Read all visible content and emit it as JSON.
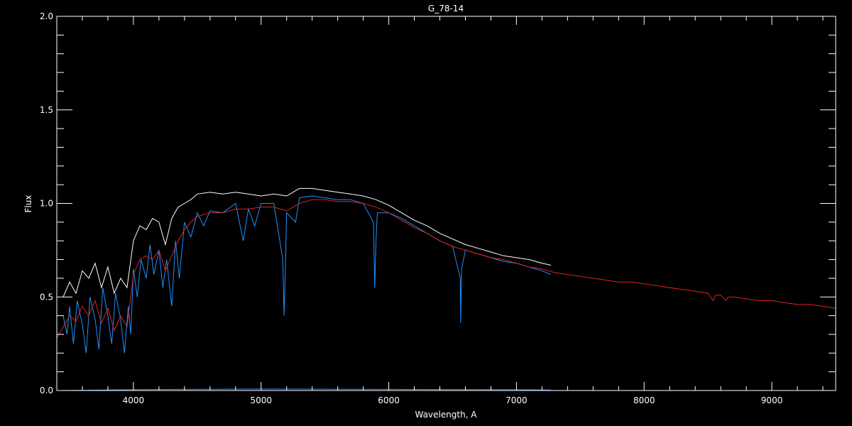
{
  "chart_data": {
    "type": "line",
    "title": "G_78-14",
    "xlabel": "Wavelength, A",
    "ylabel": "Flux",
    "xlim": [
      3400,
      9500
    ],
    "ylim": [
      0,
      2.0
    ],
    "x_ticks": [
      4000,
      5000,
      6000,
      7000,
      8000,
      9000
    ],
    "x_tick_labels": [
      "4000",
      "5000",
      "6000",
      "7000",
      "8000",
      "9000"
    ],
    "y_ticks": [
      0.0,
      0.5,
      1.0,
      1.5,
      2.0
    ],
    "y_tick_labels": [
      "0.0",
      "0.5",
      "1.0",
      "1.5",
      "2.0"
    ],
    "background": "#000000",
    "axis_color": "#ffffff",
    "series": [
      {
        "color": "#ffffff",
        "x": [
          3450,
          3500,
          3550,
          3600,
          3650,
          3700,
          3750,
          3800,
          3850,
          3900,
          3950,
          4000,
          4050,
          4100,
          4150,
          4200,
          4250,
          4300,
          4350,
          4400,
          4450,
          4500,
          4600,
          4700,
          4800,
          4900,
          5000,
          5100,
          5200,
          5300,
          5400,
          5500,
          5600,
          5700,
          5800,
          5900,
          6000,
          6100,
          6200,
          6300,
          6400,
          6500,
          6600,
          6700,
          6800,
          6900,
          7000,
          7100,
          7200,
          7270
        ],
        "y": [
          0.5,
          0.58,
          0.52,
          0.64,
          0.6,
          0.68,
          0.55,
          0.66,
          0.52,
          0.6,
          0.55,
          0.8,
          0.88,
          0.86,
          0.92,
          0.9,
          0.78,
          0.92,
          0.98,
          1.0,
          1.02,
          1.05,
          1.06,
          1.05,
          1.06,
          1.05,
          1.04,
          1.05,
          1.04,
          1.08,
          1.08,
          1.07,
          1.06,
          1.05,
          1.04,
          1.02,
          0.99,
          0.95,
          0.91,
          0.88,
          0.84,
          0.81,
          0.78,
          0.76,
          0.74,
          0.72,
          0.71,
          0.7,
          0.68,
          0.67
        ]
      },
      {
        "color": "#1e90ff",
        "x": [
          3450,
          3480,
          3500,
          3530,
          3560,
          3600,
          3630,
          3660,
          3700,
          3730,
          3760,
          3800,
          3830,
          3860,
          3900,
          3930,
          3960,
          3980,
          4000,
          4030,
          4060,
          4100,
          4130,
          4160,
          4200,
          4230,
          4260,
          4300,
          4330,
          4360,
          4400,
          4450,
          4500,
          4550,
          4600,
          4700,
          4800,
          4860,
          4900,
          4950,
          5000,
          5100,
          5170,
          5180,
          5190,
          5200,
          5270,
          5300,
          5400,
          5500,
          5600,
          5700,
          5800,
          5880,
          5890,
          5900,
          5910,
          6000,
          6100,
          6200,
          6300,
          6400,
          6500,
          6560,
          6563,
          6570,
          6600,
          6700,
          6800,
          6900,
          7000,
          7100,
          7200,
          7270
        ],
        "y": [
          0.4,
          0.3,
          0.45,
          0.25,
          0.48,
          0.35,
          0.2,
          0.5,
          0.38,
          0.22,
          0.55,
          0.4,
          0.25,
          0.52,
          0.38,
          0.2,
          0.45,
          0.3,
          0.65,
          0.5,
          0.7,
          0.6,
          0.78,
          0.62,
          0.75,
          0.55,
          0.7,
          0.45,
          0.8,
          0.6,
          0.9,
          0.82,
          0.95,
          0.88,
          0.96,
          0.95,
          1.0,
          0.8,
          0.97,
          0.88,
          1.0,
          1.0,
          0.7,
          0.4,
          0.65,
          0.95,
          0.9,
          1.03,
          1.04,
          1.03,
          1.02,
          1.02,
          1.0,
          0.9,
          0.55,
          0.8,
          0.95,
          0.95,
          0.92,
          0.88,
          0.84,
          0.8,
          0.77,
          0.6,
          0.36,
          0.65,
          0.75,
          0.73,
          0.71,
          0.69,
          0.68,
          0.66,
          0.64,
          0.62
        ]
      },
      {
        "color": "#e02020",
        "x": [
          3400,
          3450,
          3500,
          3550,
          3600,
          3650,
          3700,
          3750,
          3800,
          3850,
          3900,
          3950,
          4000,
          4050,
          4100,
          4150,
          4200,
          4250,
          4300,
          4350,
          4400,
          4450,
          4500,
          4600,
          4700,
          4800,
          4900,
          5000,
          5100,
          5200,
          5300,
          5400,
          5500,
          5600,
          5700,
          5800,
          5900,
          6000,
          6100,
          6200,
          6300,
          6400,
          6500,
          6600,
          6700,
          6800,
          6900,
          7000,
          7100,
          7200,
          7300,
          7400,
          7500,
          7600,
          7700,
          7800,
          7900,
          8000,
          8100,
          8200,
          8300,
          8400,
          8500,
          8540,
          8560,
          8600,
          8640,
          8660,
          8700,
          8800,
          8900,
          9000,
          9100,
          9200,
          9300,
          9400,
          9500
        ],
        "y": [
          0.28,
          0.34,
          0.4,
          0.37,
          0.45,
          0.4,
          0.48,
          0.36,
          0.44,
          0.32,
          0.4,
          0.34,
          0.62,
          0.7,
          0.72,
          0.7,
          0.75,
          0.64,
          0.72,
          0.8,
          0.86,
          0.9,
          0.93,
          0.95,
          0.95,
          0.97,
          0.97,
          0.98,
          0.98,
          0.96,
          1.0,
          1.02,
          1.02,
          1.01,
          1.01,
          1.0,
          0.98,
          0.95,
          0.91,
          0.87,
          0.84,
          0.8,
          0.77,
          0.75,
          0.73,
          0.71,
          0.7,
          0.68,
          0.66,
          0.65,
          0.63,
          0.62,
          0.61,
          0.6,
          0.59,
          0.58,
          0.58,
          0.57,
          0.56,
          0.55,
          0.54,
          0.53,
          0.52,
          0.48,
          0.51,
          0.51,
          0.48,
          0.5,
          0.5,
          0.49,
          0.48,
          0.48,
          0.47,
          0.46,
          0.46,
          0.45,
          0.44
        ]
      },
      {
        "color": "#1e90ff",
        "x": [
          3450,
          4000,
          5000,
          6000,
          7000,
          7270
        ],
        "y": [
          0.0,
          0.005,
          0.008,
          0.006,
          0.004,
          0.003
        ]
      }
    ]
  }
}
